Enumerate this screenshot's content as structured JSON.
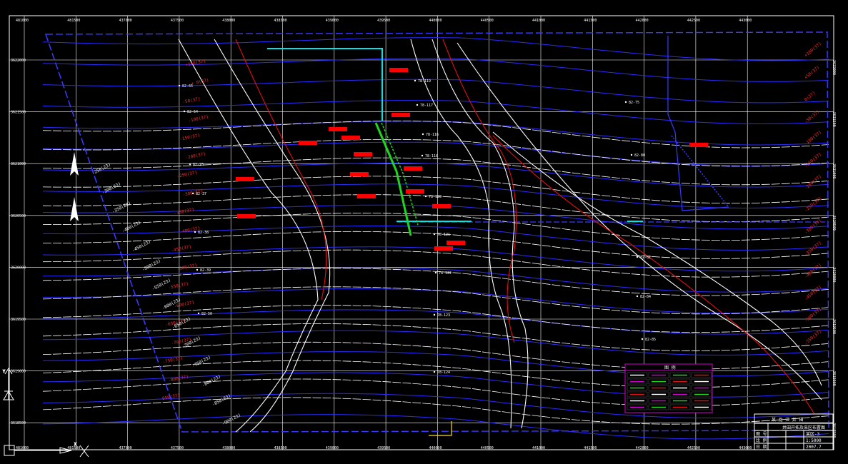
{
  "drawing": {
    "background": "#000000",
    "colors": {
      "grid": "#ffffff",
      "boundary": "#3a3aff",
      "contour_blue": "#2b2bff",
      "contour_white": "#ffffff",
      "road_red": "#e01010",
      "annotation_red": "#ff2a2a",
      "label_block": "#ff0000",
      "cyan": "#00e5e5",
      "green": "#1fd61f",
      "yellow": "#ffe000",
      "magenta": "#d000d0"
    },
    "x_ticks": [
      "481000",
      "481500",
      "437000",
      "437500",
      "438000",
      "438500",
      "439000",
      "439500",
      "440000",
      "440500",
      "441000",
      "441500",
      "442000",
      "442500",
      "443000"
    ],
    "y_ticks": [
      "3622000",
      "3621500",
      "3621000",
      "3620500",
      "3620000",
      "3619500",
      "3619000",
      "3618500"
    ],
    "contour_labels_left": [
      "+150(37)",
      "+ 0(37)",
      "-50(37)",
      "-100(37)",
      "-150(37)",
      "-200(37)",
      "-250(37)",
      "-300(37)",
      "-350(37)",
      "-400(37)",
      "-450(37)",
      "-500(37)",
      "-550(37)",
      "-600(37)",
      "-650(37)",
      "-700(37)",
      "-750(37)",
      "-800(37)",
      "-850(37)"
    ],
    "contour_labels_right": [
      "+100(37)",
      "+50(37)",
      "0(37)",
      "-50(37)",
      "-100(37)",
      "-150(37)",
      "-200(37)",
      "-250(37)",
      "-300(37)",
      "-350(37)",
      "-400(37)",
      "-450(37)",
      "-500(37)",
      "-550(37)"
    ],
    "white_labels": [
      "-250(23)",
      "-300(23)",
      "-350(23)",
      "-400(23)",
      "-450(23)",
      "-500(23)",
      "-550(23)",
      "-600(23)",
      "-650(23)",
      "-700(23)",
      "-750(23)",
      "-800(23)",
      "-850(23)",
      "-900(23)"
    ],
    "borehole_labels": [
      "82-65",
      "82-54",
      "82-28",
      "82-37",
      "82-38",
      "82-39",
      "82-50",
      "78-119",
      "78-117",
      "78-116",
      "78-118",
      "78-120",
      "78-121",
      "78-122",
      "78-123",
      "78-124",
      "82-75",
      "82-80",
      "82-82",
      "82-84",
      "82-85"
    ],
    "title_block": {
      "title": "某 龙 江 井 田 ",
      "subtitle": "井田开拓及采区布置图",
      "rows": [
        "图 号",
        "比 例",
        "日 期"
      ],
      "values": [
        "某区-3",
        "1:5000",
        "2007.7"
      ]
    },
    "legend_title": "图 例",
    "ucs_labels": {
      "y": "Y",
      "x": "X"
    }
  }
}
